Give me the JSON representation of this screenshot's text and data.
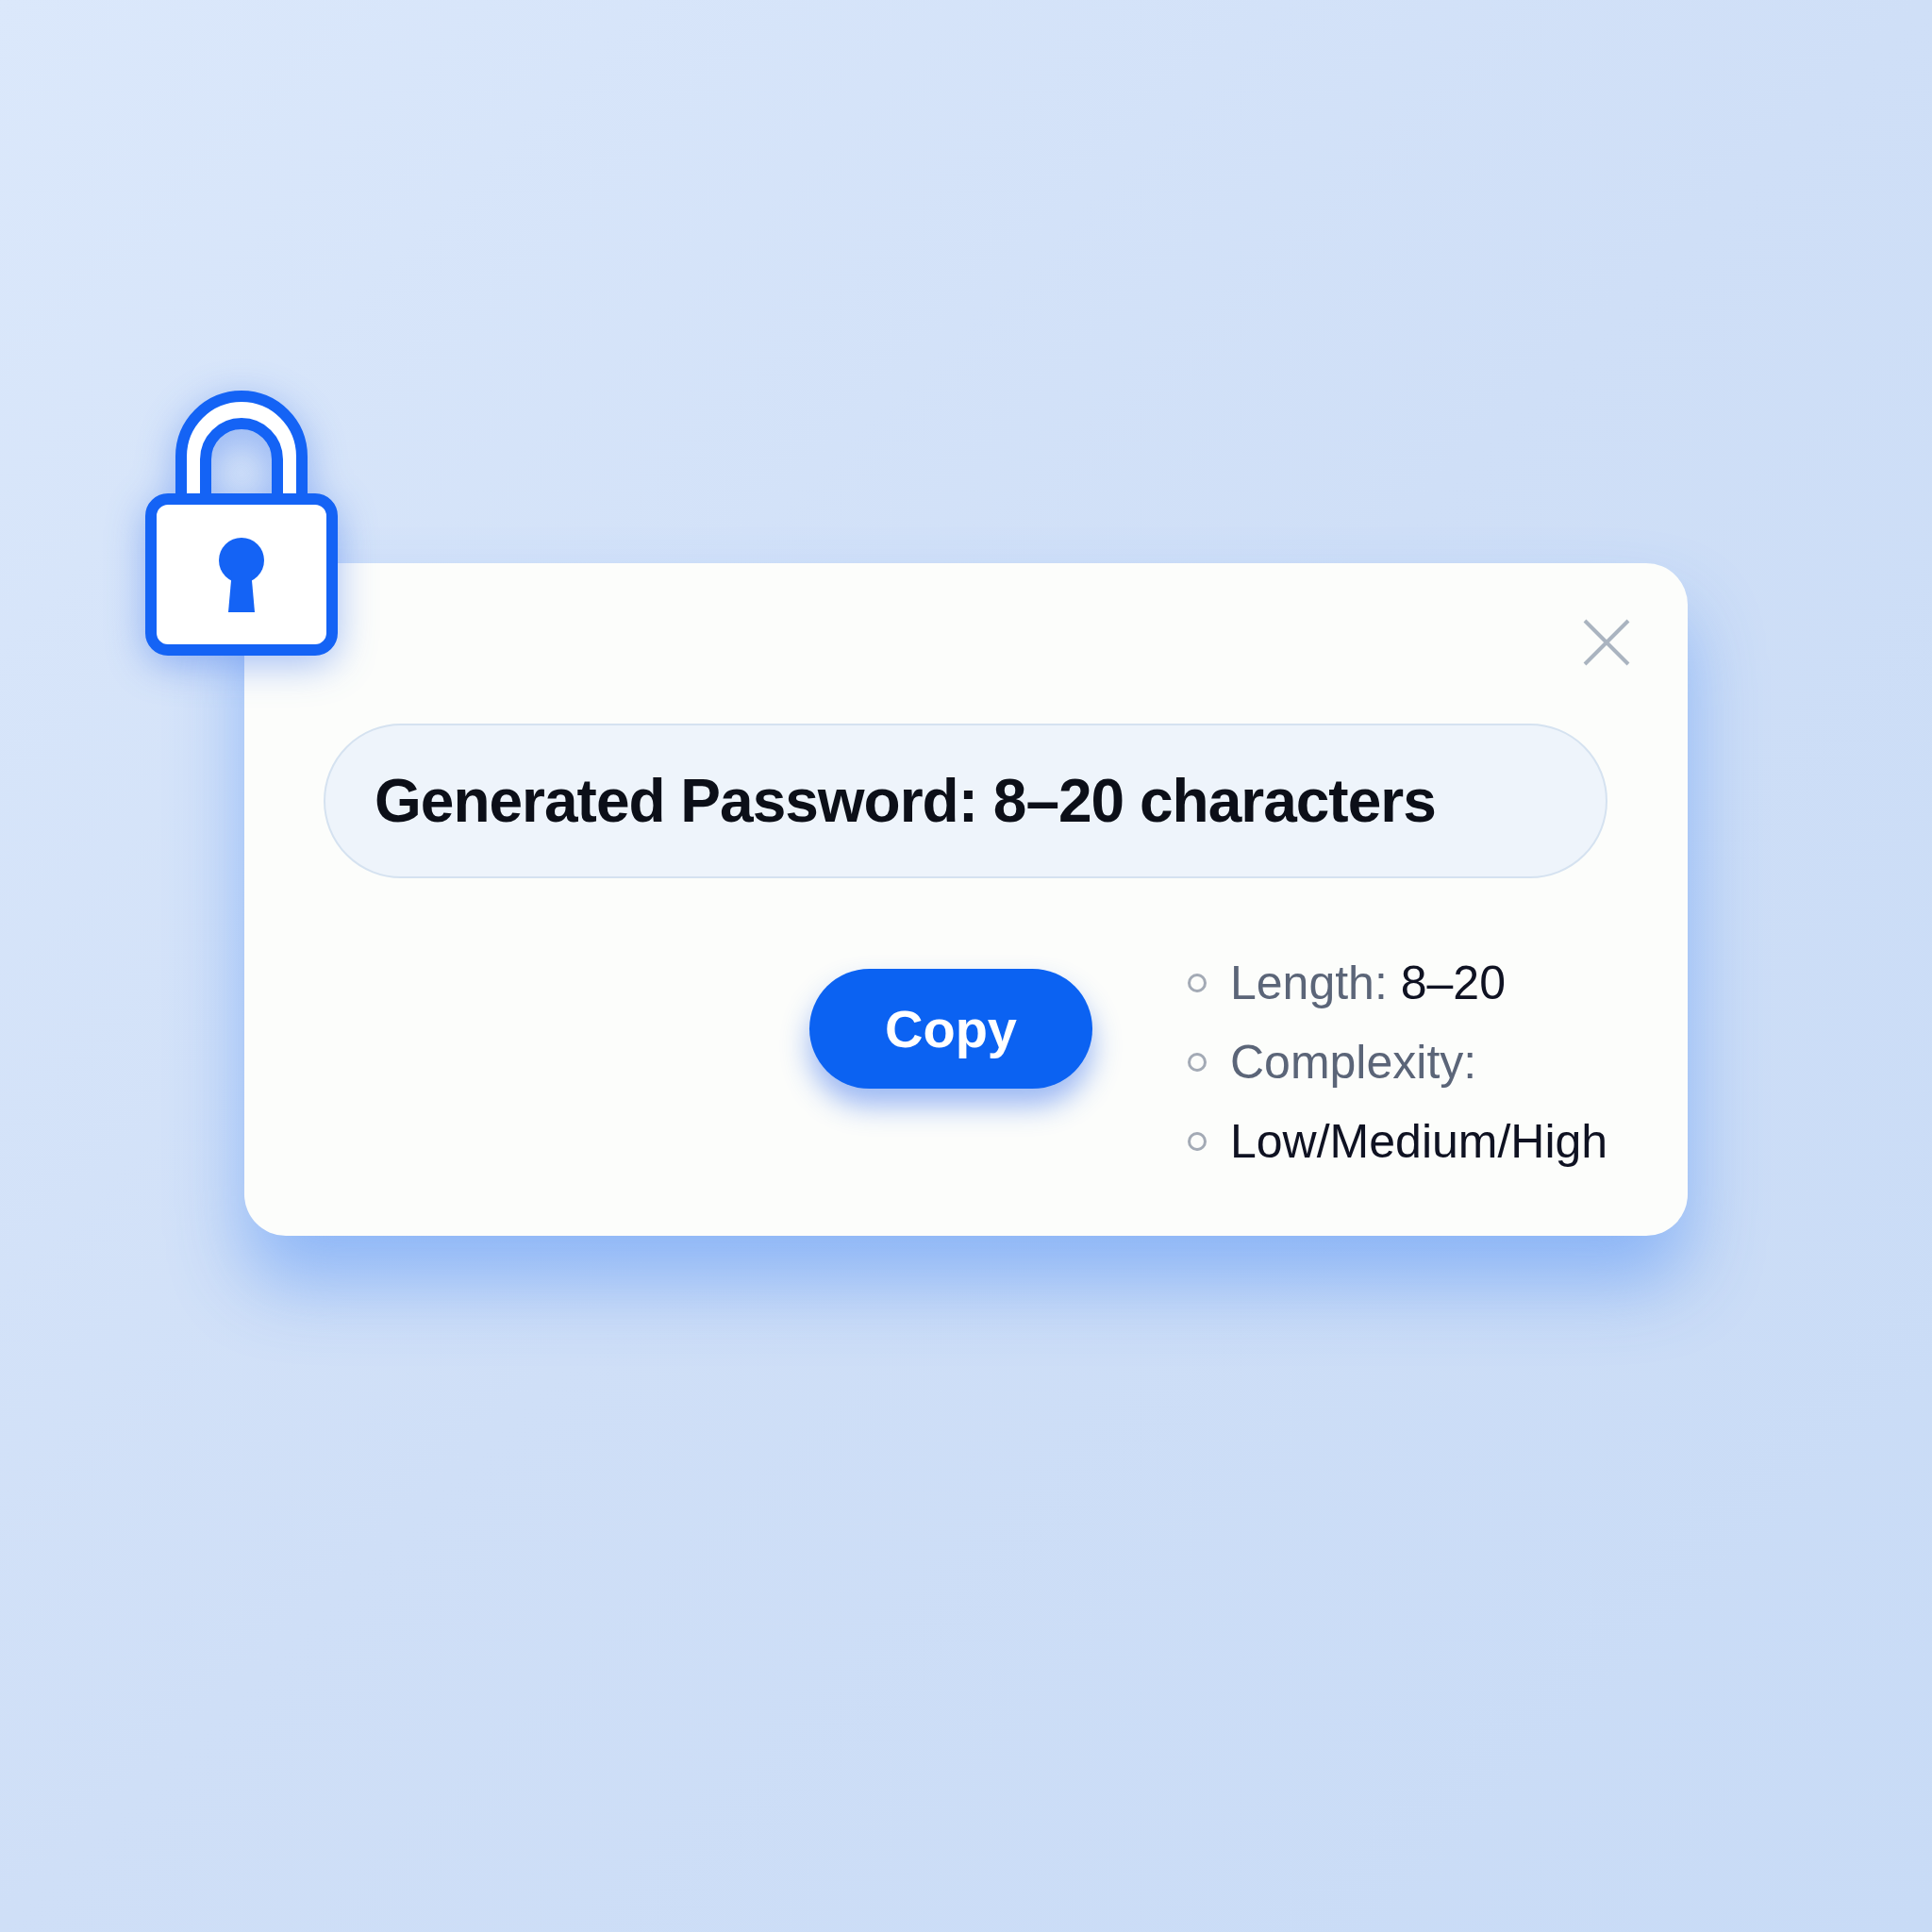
{
  "dialog": {
    "field": {
      "value": "Generated Password: 8–20 characters"
    },
    "copy_button": {
      "label": "Copy"
    },
    "options": [
      {
        "parts": [
          {
            "text": "Length:",
            "kind": "muted"
          },
          {
            "text": "8–20",
            "kind": "strong"
          }
        ]
      },
      {
        "parts": [
          {
            "text": "Complexity:",
            "kind": "muted"
          }
        ]
      },
      {
        "parts": [
          {
            "text": "Low/Medium/High",
            "kind": "strong"
          }
        ]
      }
    ]
  }
}
